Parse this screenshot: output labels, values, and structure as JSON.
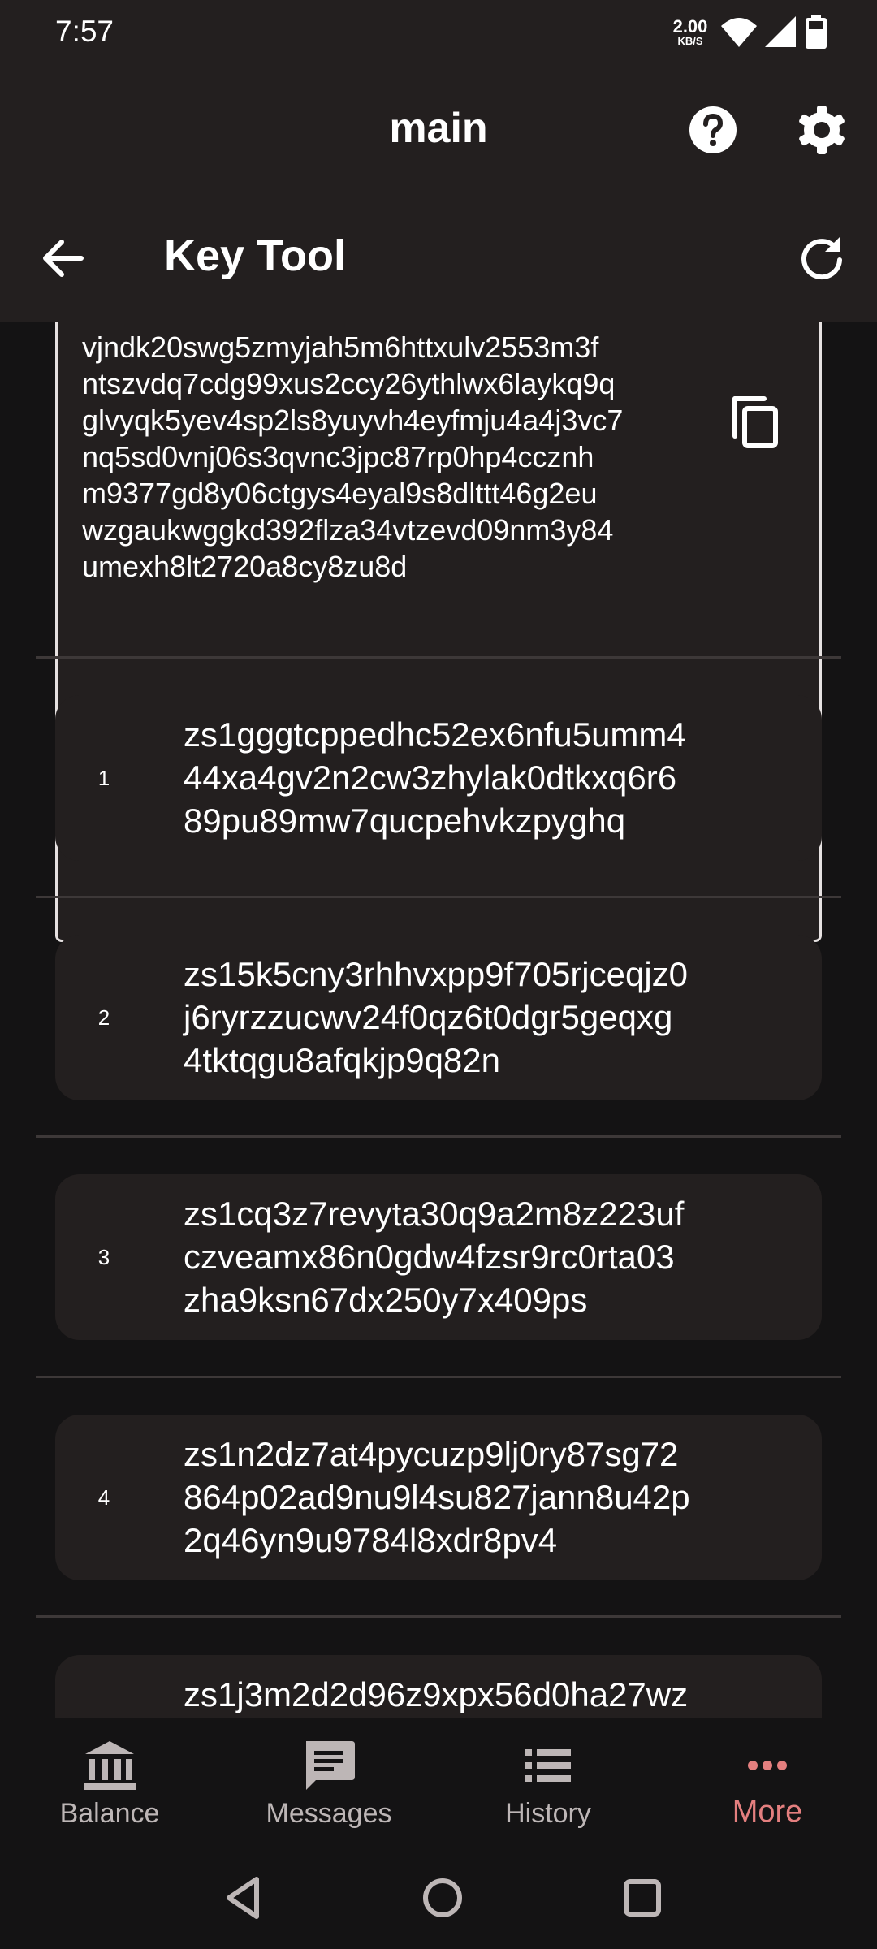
{
  "status": {
    "time": "7:57",
    "speed_value": "2.00",
    "speed_unit": "KB/S",
    "icons": [
      "wifi-icon",
      "signal-icon",
      "battery-icon"
    ]
  },
  "app_bar": {
    "title": "main",
    "icons": [
      "help-icon",
      "settings-icon"
    ]
  },
  "sub_bar": {
    "title": "Key Tool",
    "icons": [
      "back-arrow-icon",
      "refresh-icon"
    ]
  },
  "key_box": {
    "text": "vjndk20swg5zmyjah5m6httxulv2553m3f\nntszvdq7cdg99xus2ccy26ythlwx6laykq9q\nglvyqk5yev4sp2ls8yuyvh4eyfmju4a4j3vc7\nnq5sd0vnj06s3qvnc3jpc87rp0hp4ccznh\nm9377gd8y06ctgys4eyal9s8dlttt46g2eu\nwzgaukwggkd392flza34vtzevd09nm3y84\numexh8lt2720a8cy8zu8d",
    "copy_icon": "copy-icon"
  },
  "addresses": [
    {
      "index": "1",
      "text": "zs1gggtcppedhc52ex6nfu5umm4\n44xa4gv2n2cw3zhylak0dtkxq6r6\n89pu89mw7qucpehvkzpyghq"
    },
    {
      "index": "2",
      "text": "zs15k5cny3rhhvxpp9f705rjceqjz0\nj6ryrzzucwv24f0qz6t0dgr5geqxg\n4tktqgu8afqkjp9q82n"
    },
    {
      "index": "3",
      "text": "zs1cq3z7revyta30q9a2m8z223uf\nczveamx86n0gdw4fzsr9rc0rta03\nzha9ksn67dx250y7x409ps"
    },
    {
      "index": "4",
      "text": "zs1n2dz7at4pycuzp9lj0ry87sg72\n864p02ad9nu9l4su827jann8u42p\n2q46yn9u9784l8xdr8pv4"
    },
    {
      "index": "",
      "text": "zs1j3m2d2d96z9xpx56d0ha27wz"
    }
  ],
  "bottom_nav": [
    {
      "label": "Balance",
      "icon": "bank-icon",
      "active": false
    },
    {
      "label": "Messages",
      "icon": "message-icon",
      "active": false
    },
    {
      "label": "History",
      "icon": "list-icon",
      "active": false
    },
    {
      "label": "More",
      "icon": "more-dots-icon",
      "active": true
    }
  ],
  "colors": {
    "background": "#141314",
    "surface": "#231f1f",
    "accent": "#e47f7f",
    "muted_text": "#bdb6b6"
  }
}
